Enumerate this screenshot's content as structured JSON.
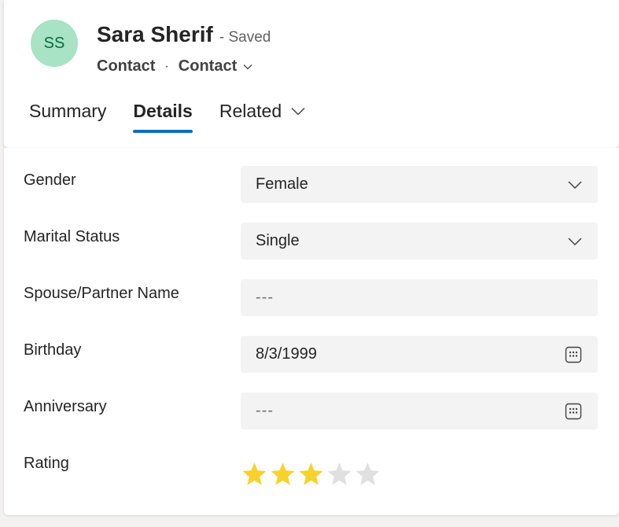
{
  "header": {
    "avatar_initials": "SS",
    "record_name": "Sara Sherif",
    "save_status": "- Saved",
    "entity_name": "Contact",
    "separator": "·",
    "form_name": "Contact"
  },
  "tabs": [
    {
      "label": "Summary",
      "active": false
    },
    {
      "label": "Details",
      "active": true
    },
    {
      "label": "Related",
      "active": false
    }
  ],
  "fields": {
    "gender": {
      "label": "Gender",
      "value": "Female"
    },
    "marital_status": {
      "label": "Marital Status",
      "value": "Single"
    },
    "spouse": {
      "label": "Spouse/Partner Name",
      "value": "---"
    },
    "birthday": {
      "label": "Birthday",
      "value": "8/3/1999"
    },
    "anniversary": {
      "label": "Anniversary",
      "value": "---"
    },
    "rating": {
      "label": "Rating",
      "value": 3,
      "max": 5
    }
  },
  "colors": {
    "accent": "#0f6cbd",
    "avatar_bg": "#a7e3c4",
    "avatar_text": "#0b6a3b",
    "star_filled": "#f8d22a",
    "star_empty": "#e0e0e0"
  },
  "icons": {
    "dropdown": "chevron-down-icon",
    "date_picker": "calendar-icon",
    "rating": "star-icon"
  }
}
